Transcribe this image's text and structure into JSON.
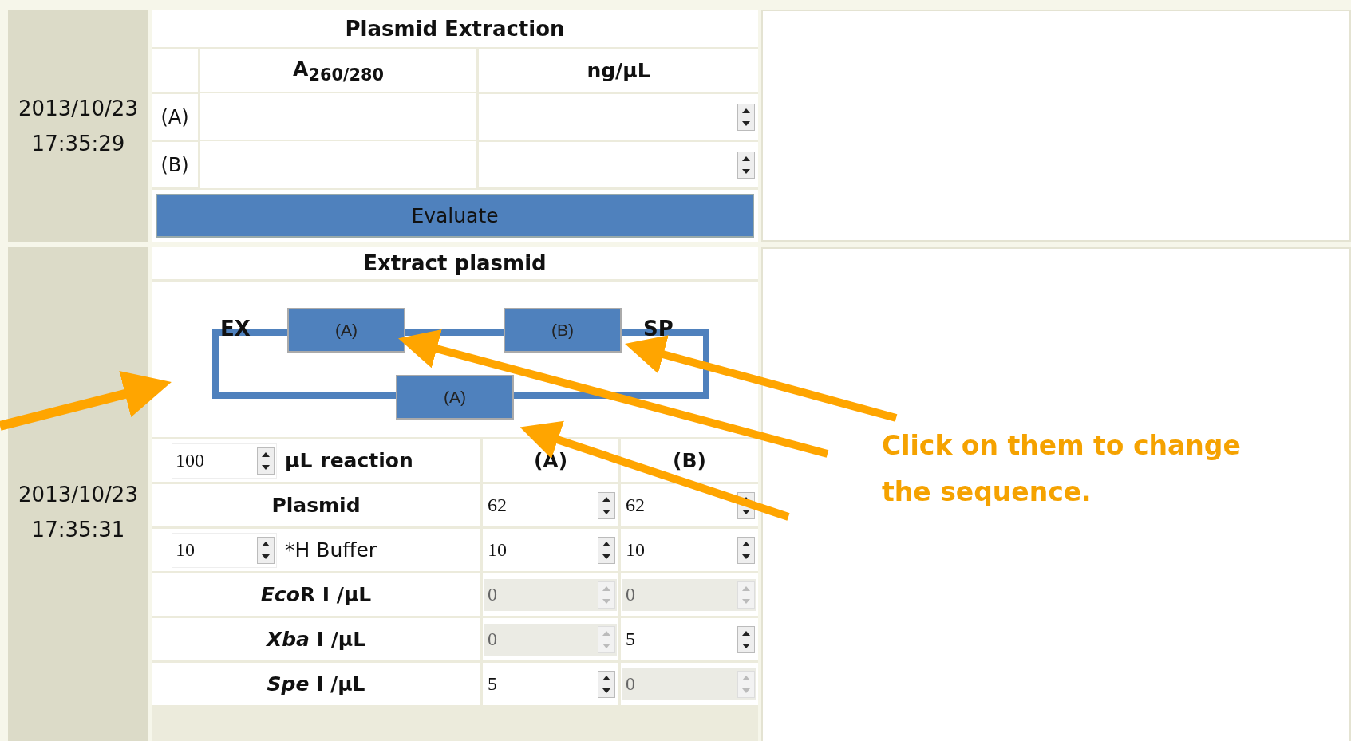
{
  "plasmid_extraction": {
    "date": "2013/10/23",
    "time": "17:35:29",
    "title": "Plasmid Extraction",
    "columns": [
      "A$_{260/280}$",
      "ng/μL"
    ],
    "rows": [
      {
        "label": "(A)"
      },
      {
        "label": "(B)"
      }
    ],
    "button": "Evaluate"
  },
  "extract_plasmid": {
    "date": "2013/10/23",
    "time": "17:35:31",
    "title": "Extract plasmid",
    "diagram": {
      "left_label": "EX",
      "right_label": "SP",
      "top_blocks": [
        {
          "label": "(A)"
        },
        {
          "label": "(B)"
        }
      ],
      "bottom_block": {
        "label": "(A)"
      }
    },
    "reaction": {
      "volume": "100",
      "unit": "μL",
      "label": "reaction",
      "columns": [
        "(A)",
        "(B)"
      ]
    },
    "rows": [
      {
        "kind": "plain",
        "label": "Plasmid",
        "cells": [
          {
            "value": "62",
            "disabled": false
          },
          {
            "value": "62",
            "disabled": false
          }
        ]
      },
      {
        "kind": "input",
        "input_value": "10",
        "label": "*H Buffer",
        "cells": [
          {
            "value": "10",
            "disabled": false
          },
          {
            "value": "10",
            "disabled": false
          }
        ]
      },
      {
        "kind": "enzyme",
        "italic": "Eco",
        "label": "R I /μL",
        "cells": [
          {
            "value": "0",
            "disabled": true
          },
          {
            "value": "0",
            "disabled": true
          }
        ]
      },
      {
        "kind": "enzyme",
        "italic": "Xba",
        "label": " I /μL",
        "cells": [
          {
            "value": "0",
            "disabled": true
          },
          {
            "value": "5",
            "disabled": false
          }
        ]
      },
      {
        "kind": "enzyme",
        "italic": "Spe",
        "label": " I /μL",
        "cells": [
          {
            "value": "5",
            "disabled": false
          },
          {
            "value": "0",
            "disabled": true
          }
        ]
      }
    ]
  },
  "annotation": {
    "lines": [
      "Click on them to change",
      "the sequence."
    ]
  }
}
